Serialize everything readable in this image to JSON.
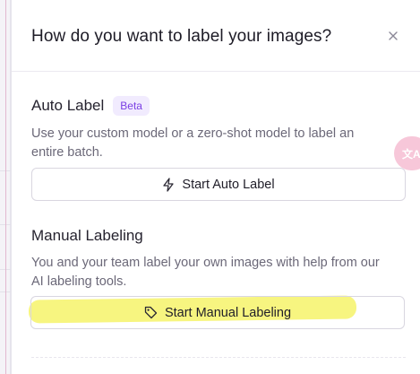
{
  "modal": {
    "title": "How do you want to label your images?",
    "close_icon": "close-icon"
  },
  "auto_label": {
    "title": "Auto Label",
    "badge": "Beta",
    "description": "Use your custom model or a zero-shot model to label an entire batch.",
    "button_label": "Start Auto Label",
    "button_icon": "lightning-icon"
  },
  "manual_labeling": {
    "title": "Manual Labeling",
    "description": "You and your team label your own images with help from our AI labeling tools.",
    "button_label": "Start Manual Labeling",
    "button_icon": "tag-icon"
  },
  "colors": {
    "badge_bg": "#f1ebfe",
    "badge_text": "#7b3fe4",
    "highlight": "#f6f36a",
    "translate_fab": "#f7c7d9"
  },
  "translate_fab": {
    "icon": "translate-icon",
    "label": "文A"
  }
}
